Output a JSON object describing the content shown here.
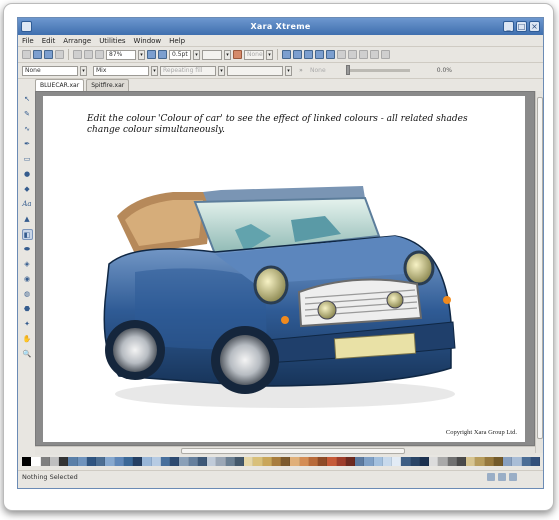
{
  "window": {
    "title": "Xara Xtreme"
  },
  "menu": [
    "File",
    "Edit",
    "Arrange",
    "Utilities",
    "Window",
    "Help"
  ],
  "toolbar": {
    "zoom_value": "87%",
    "line_width_value": "0.5pt",
    "name_field_placeholder": "None"
  },
  "toolbar2": {
    "fill_type": "None",
    "blend_type": "Mix",
    "repeating_fill": "Repeating fill",
    "opacity_label": "None",
    "opacity_value": "0.0%"
  },
  "tabs": [
    {
      "label": "BLUECAR.xar",
      "active": true
    },
    {
      "label": "Spitfire.xar",
      "active": false
    }
  ],
  "document": {
    "caption": "Edit the colour 'Colour of car' to see the effect of linked colours - all related shades change colour simultaneously.",
    "copyright": "Copyright Xara Group Ltd."
  },
  "status": {
    "text": "Nothing Selected"
  },
  "palette_colors": [
    "#000000",
    "#ffffff",
    "#7f7f7f",
    "#bfbfbf",
    "#333333",
    "#5a7fa8",
    "#6f93bd",
    "#2f5480",
    "#4c6e93",
    "#86a8cf",
    "#5f87b8",
    "#3a6796",
    "#243f63",
    "#98b6d8",
    "#b6cbe3",
    "#476f9c",
    "#2d4a70",
    "#8aa0b8",
    "#657f9d",
    "#3d5878",
    "#c0cbd9",
    "#9ba7b6",
    "#6b7f92",
    "#44586b",
    "#e6d7a8",
    "#d9c07a",
    "#c9a65a",
    "#a87d3e",
    "#7d5a2e",
    "#e0b07a",
    "#d48d55",
    "#b86a3a",
    "#8f4b27",
    "#c65a38",
    "#9e3d2b",
    "#6d2a20",
    "#5c7aa0",
    "#7fa0c6",
    "#a3c0de",
    "#c7d9ec",
    "#e2ebf5",
    "#3e5e84",
    "#2a4566",
    "#1c3150",
    "#dcdcdc",
    "#a9a9a9",
    "#707070",
    "#4a4a4a",
    "#d7c48f",
    "#b79c5c",
    "#96783d",
    "#735a2a",
    "#88a0c0",
    "#a9bdd6",
    "#4b6d95",
    "#33507a"
  ]
}
